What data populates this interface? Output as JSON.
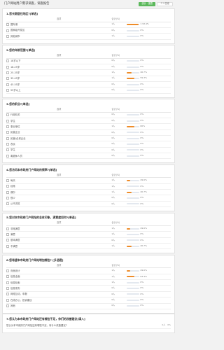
{
  "header": {
    "title": "门户网站用户需求调查，调查报告",
    "btn_active": "统计 · 图表",
    "btn_inactive": "个人答卷"
  },
  "table_header": {
    "option": "选项",
    "stat": "合计(%)"
  },
  "questions": [
    {
      "title": "1.您长期居住地区?[单选]",
      "options": [
        {
          "label": "国际港",
          "count": "1人",
          "pct": "1 93.4%",
          "value": 0.934
        },
        {
          "label": "国家级开发区",
          "count": "0人",
          "pct": "0%",
          "value": 0.0
        },
        {
          "label": "其他城市",
          "count": "1人",
          "pct": "0%",
          "value": 0.0
        }
      ]
    },
    {
      "title": "2.您的年龄范围?[单选]",
      "options": [
        {
          "label": "18岁以下",
          "count": "0人",
          "pct": "0%",
          "value": 0.0
        },
        {
          "label": "18-25岁",
          "count": "0人",
          "pct": "0%",
          "value": 0.0
        },
        {
          "label": "25-35岁",
          "count": "1人",
          "pct": "40.7%",
          "value": 0.407
        },
        {
          "label": "35-45岁",
          "count": "1人",
          "pct": "59.3%",
          "value": 0.593
        },
        {
          "label": "45-55岁",
          "count": "0人",
          "pct": "0%",
          "value": 0.0
        },
        {
          "label": "55岁以上",
          "count": "0人",
          "pct": "0%",
          "value": 0.0
        }
      ]
    },
    {
      "title": "3.您的职业?[单选]",
      "options": [
        {
          "label": "行政机关",
          "count": "0人",
          "pct": "0%",
          "value": 0.0
        },
        {
          "label": "学生",
          "count": "0人",
          "pct": "0%",
          "value": 0.0
        },
        {
          "label": "事业单位",
          "count": "1人",
          "pct": "60%",
          "value": 0.6
        },
        {
          "label": "民营企业",
          "count": "0人",
          "pct": "0%",
          "value": 0.0
        },
        {
          "label": "民营/合资企业",
          "count": "0人",
          "pct": "0%",
          "value": 0.0
        },
        {
          "label": "农民",
          "count": "0人",
          "pct": "0%",
          "value": 0.0
        },
        {
          "label": "学生",
          "count": "0人",
          "pct": "0%",
          "value": 0.0
        },
        {
          "label": "离退休人员",
          "count": "0人",
          "pct": "0%",
          "value": 0.0
        }
      ]
    },
    {
      "title": "4.您访问本市政府门户网站的频率?[单选]",
      "options": [
        {
          "label": "每天",
          "count": "1人",
          "pct": "29.6%",
          "value": 0.296
        },
        {
          "label": "经常",
          "count": "1人",
          "pct": "0%",
          "value": 0.0
        },
        {
          "label": "偶尔",
          "count": "1人",
          "pct": "40.7%",
          "value": 0.407
        },
        {
          "label": "很少",
          "count": "0人",
          "pct": "0%",
          "value": 0.0
        },
        {
          "label": "从不浏览",
          "count": "0人",
          "pct": "0%",
          "value": 0.0
        }
      ]
    },
    {
      "title": "5.您对本市政府门户网站的总体印象，满意度如何?[单选]",
      "options": [
        {
          "label": "非常满意",
          "count": "1人",
          "pct": "29.6%",
          "value": 0.296
        },
        {
          "label": "满意",
          "count": "1人",
          "pct": "0%",
          "value": 0.0
        },
        {
          "label": "基本满意",
          "count": "0人",
          "pct": "0%",
          "value": 0.0
        },
        {
          "label": "不满意",
          "count": "1人",
          "pct": "40.7%",
          "value": 0.407
        }
      ]
    },
    {
      "title": "6.您希望本市政府门户网站增加哪些? [多选题]",
      "options": [
        {
          "label": "页面设计",
          "count": "1人",
          "pct": "29.6%",
          "value": 0.296
        },
        {
          "label": "信息全面",
          "count": "1人",
          "pct": "63.4%",
          "value": 0.634
        },
        {
          "label": "信息检索",
          "count": "1人",
          "pct": "0%",
          "value": 0.0
        },
        {
          "label": "信息发布",
          "count": "0人",
          "pct": "0%",
          "value": 0.0
        },
        {
          "label": "网络互动，申报",
          "count": "0人",
          "pct": "0%",
          "value": 0.0
        },
        {
          "label": "在线办公，投诉建议",
          "count": "0人",
          "pct": "0%",
          "value": 0.0
        },
        {
          "label": "其他",
          "count": "0人",
          "pct": "0%",
          "value": 0.0
        }
      ]
    }
  ],
  "q7": {
    "title": "7.您认为本市政府门户网站还有哪些不足，你们的改善建议[填入]",
    "row_label": "您认为本市政府门户网站还有哪些不足，有什么改善建议?",
    "row_meta1": "0人",
    "row_meta2": "0%"
  }
}
